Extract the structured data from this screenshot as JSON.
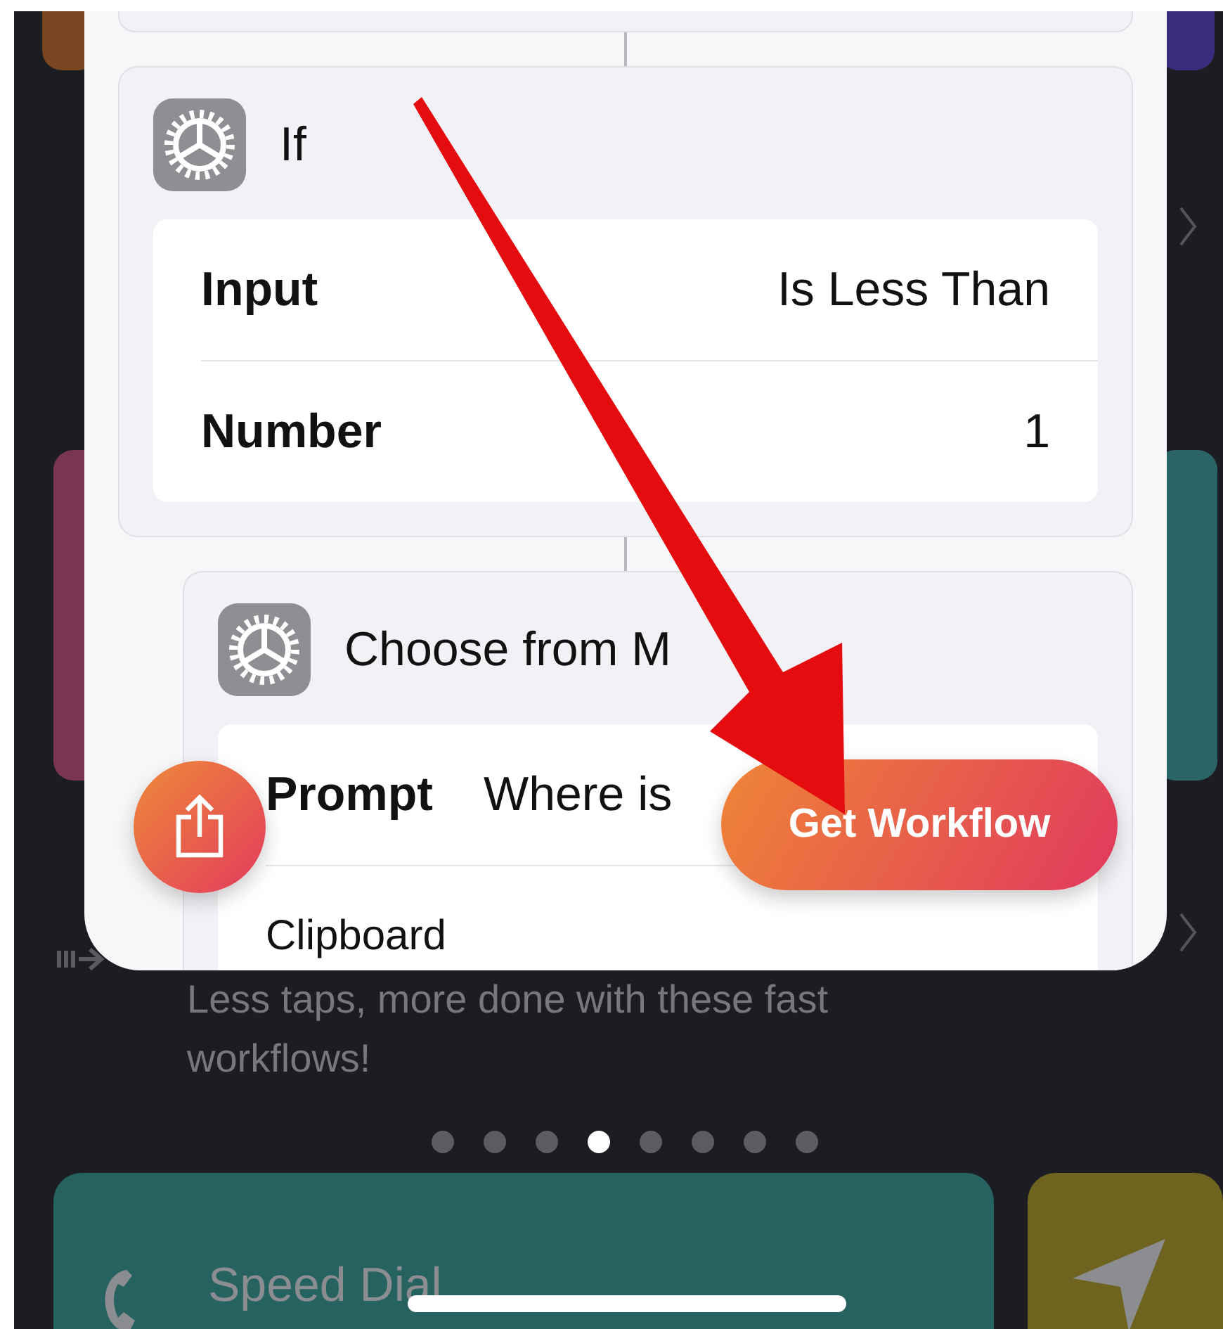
{
  "sheet": {
    "steps": [
      {
        "title": "If",
        "params": [
          {
            "kind": "param",
            "label": "Input",
            "value": "Is Less Than"
          },
          {
            "kind": "param",
            "label": "Number",
            "value": "1"
          }
        ]
      },
      {
        "title": "Choose from M",
        "params": [
          {
            "kind": "param",
            "label": "Prompt",
            "value": "Where is"
          },
          {
            "kind": "item",
            "label": "Clipboard"
          }
        ]
      }
    ],
    "primary_button": "Get Workflow"
  },
  "caption": "Less taps, more done with these fast workflows!",
  "page_dots": [
    {
      "selected": false
    },
    {
      "selected": false
    },
    {
      "selected": false
    },
    {
      "selected": true
    },
    {
      "selected": false
    },
    {
      "selected": false
    },
    {
      "selected": false
    },
    {
      "selected": false
    }
  ],
  "cards": [
    {
      "kind": "phone",
      "title": "Speed Dial",
      "color": "#266260"
    },
    {
      "kind": "location",
      "color": "#6e6420"
    }
  ]
}
